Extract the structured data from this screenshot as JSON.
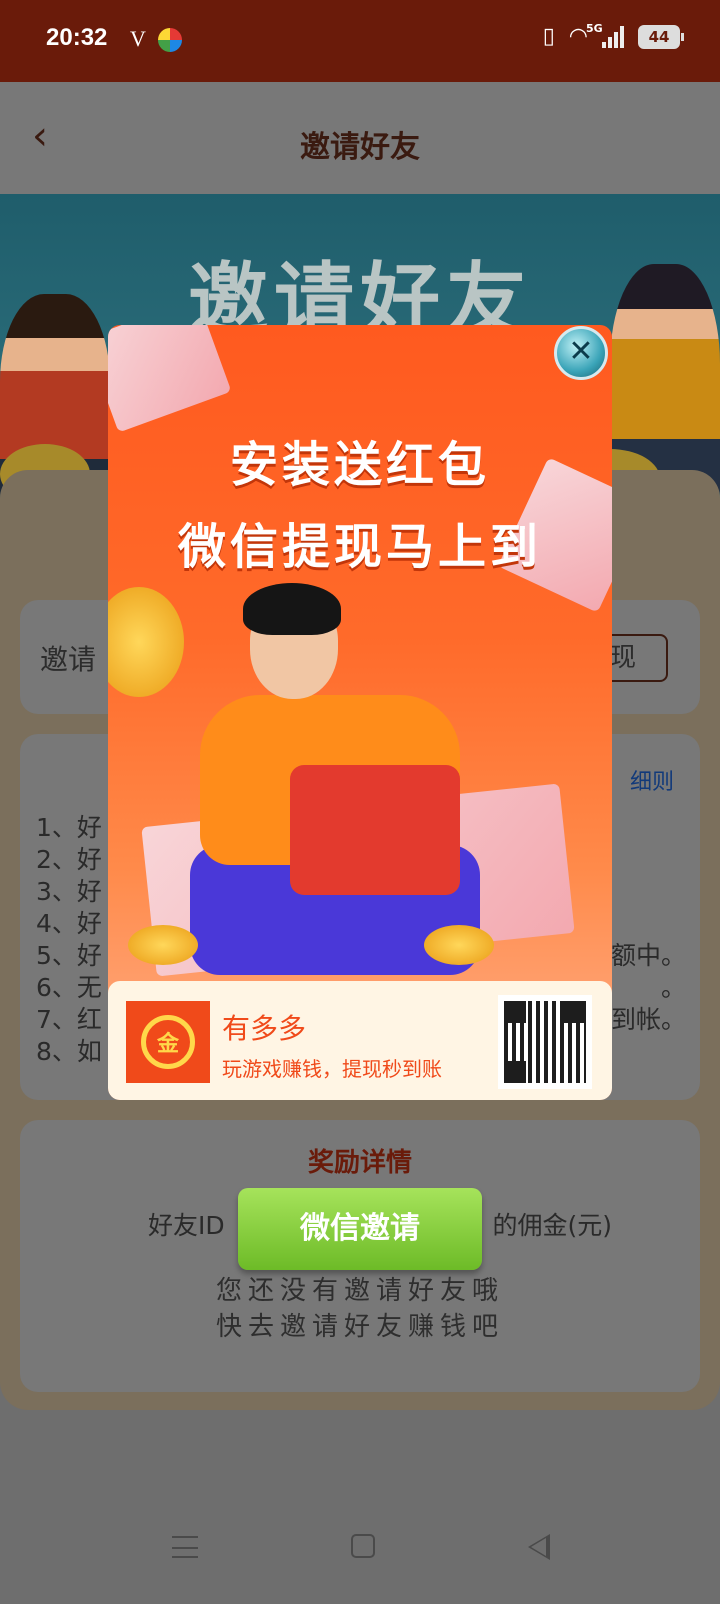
{
  "status": {
    "time": "20:32",
    "carrier_mark": "V",
    "network": "5G",
    "battery": "44"
  },
  "header": {
    "title": "邀请好友"
  },
  "banner": {
    "title": "邀请好友"
  },
  "invite_card": {
    "label": "邀请",
    "button_suffix": "现"
  },
  "rules": {
    "link": "细则",
    "items_left": [
      "1、好",
      "2、好",
      "3、好",
      "4、好",
      "5、好",
      "6、无",
      "7、红",
      "8、如"
    ],
    "items_right": {
      "r5": "额中。",
      "r6": "。",
      "r7": "到帐。"
    }
  },
  "reward": {
    "title": "奖励详情",
    "col_friend": "好友ID",
    "col_commission": "的佣金(元)",
    "empty_line1": "您还没有邀请好友哦",
    "empty_line2": "快去邀请好友赚钱吧"
  },
  "invite_button": "微信邀请",
  "ad": {
    "headline1": "安装送红包",
    "headline2": "微信提现马上到",
    "app_name": "有多多",
    "app_slogan": "玩游戏赚钱，提现秒到账",
    "logo_text": "金",
    "close_glyph": "✕"
  }
}
